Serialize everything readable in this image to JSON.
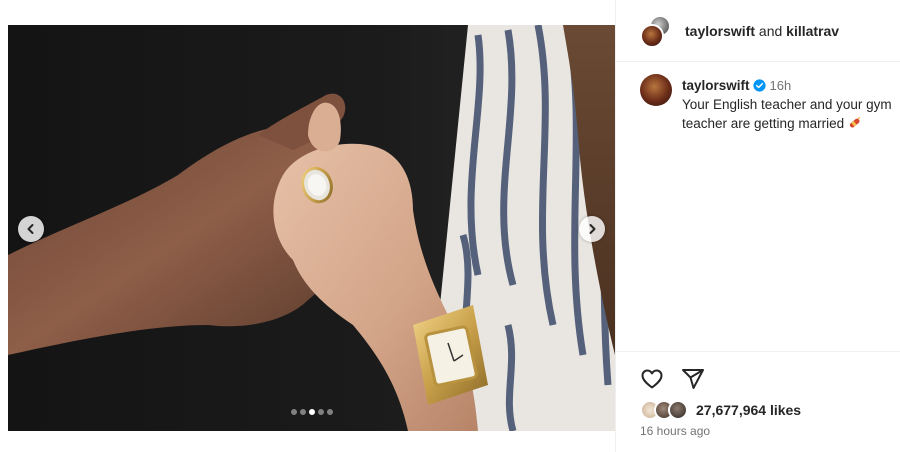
{
  "header": {
    "user_primary": "taylorswift",
    "joiner": "and",
    "user_collab": "killatrav"
  },
  "caption": {
    "username": "taylorswift",
    "time_relative": "16h",
    "text": "Your English teacher and your gym teacher are getting married"
  },
  "carousel": {
    "total_slides": 5,
    "active_slide": 3
  },
  "actions": {
    "like_icon": "heart-icon",
    "share_icon": "paper-plane-icon"
  },
  "likes_text": "27,677,964 likes",
  "posted_time": "16 hours ago",
  "colors": {
    "verified": "#0095f6",
    "text": "#262626",
    "muted": "#737373",
    "divider": "#efefef"
  }
}
